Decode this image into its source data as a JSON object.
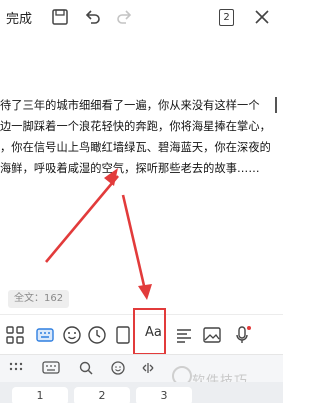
{
  "topbar": {
    "done_label": "完成",
    "page_count": "2"
  },
  "editor": {
    "lines": [
      "待了三年的城市细细看了一遍，你从来没有这样一个",
      "边一脚踩着一个浪花轻快的奔跑，你将海星捧在掌心，",
      "，你在信号山上鸟瞰红墙绿瓦、碧海蓝天，你在深夜的",
      "海鲜，呼吸着咸湿的空气，探听那些老去的故事……"
    ],
    "word_count": "全文：162"
  },
  "toolbar": {
    "font_button": "Aa",
    "icons": [
      "grid-icon",
      "keyboard-icon",
      "emoji-icon",
      "clock-icon",
      "page-icon",
      "font-icon",
      "align-icon",
      "image-icon",
      "mic-icon"
    ]
  },
  "keyboard": {
    "bar_icons": [
      "apps-icon",
      "keyboard-switch-icon",
      "search-icon",
      "emoji-icon",
      "cursor-icon",
      "mic-icon"
    ],
    "keys": [
      "1",
      "2",
      "3"
    ]
  },
  "watermark": {
    "text": "软件技巧"
  },
  "colors": {
    "annotation": "#e23b3b",
    "accent_blue": "#2f7fe0",
    "mic_dot": "#e23b3b"
  }
}
